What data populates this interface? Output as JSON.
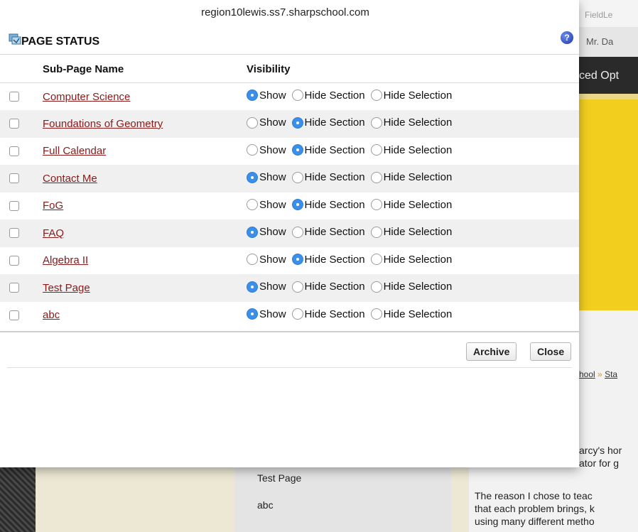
{
  "url": "region10lewis.ss7.sharpschool.com",
  "background": {
    "fieldle": "FieldLe",
    "user": "Mr. Da",
    "nav_text": "ced Opt",
    "breadcrumb": {
      "item1": "hool",
      "sep": "»",
      "item2": "Sta"
    },
    "body_line1": "arcy's hor",
    "body_line2": "ator for g",
    "para2_line1": "The reason I chose to teac",
    "para2_line2": "that each problem brings, k",
    "para2_line3": "using many different metho",
    "submenu": [
      "Test Page",
      "abc"
    ]
  },
  "dialog": {
    "title": "PAGE STATUS",
    "help_icon": "help-icon",
    "columns": {
      "name": "Sub-Page Name",
      "visibility": "Visibility"
    },
    "option_labels": [
      "Show",
      "Hide Section",
      "Hide Selection"
    ],
    "rows": [
      {
        "name": "Computer Science",
        "selected": 0
      },
      {
        "name": "Foundations of Geometry",
        "selected": 1
      },
      {
        "name": "Full Calendar",
        "selected": 1
      },
      {
        "name": "Contact Me",
        "selected": 0
      },
      {
        "name": "FoG",
        "selected": 1
      },
      {
        "name": "FAQ",
        "selected": 0
      },
      {
        "name": "Algebra II",
        "selected": 1
      },
      {
        "name": "Test Page",
        "selected": 0
      },
      {
        "name": "abc",
        "selected": 0
      }
    ],
    "buttons": {
      "archive": "Archive",
      "close": "Close"
    }
  },
  "colors": {
    "link": "#8a1a1a",
    "radio_selected": "#3b8fe8",
    "accent_yellow": "#f2cf1f"
  }
}
